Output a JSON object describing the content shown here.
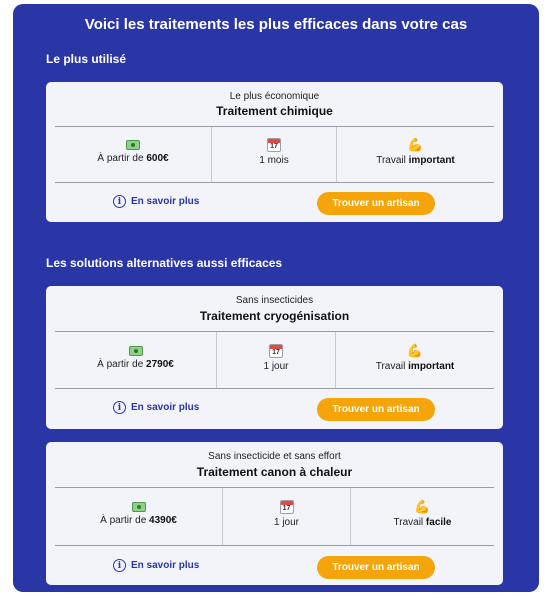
{
  "header": {
    "title": "Voici les traitements les plus efficaces dans votre cas"
  },
  "sections": [
    {
      "title": "Le plus utilisé"
    },
    {
      "title": "Les solutions alternatives aussi efficaces"
    }
  ],
  "cards": [
    {
      "subtitle": "Le plus économique",
      "name": "Traitement chimique",
      "price_prefix": "À partir de ",
      "price": "600€",
      "duration": "1 mois",
      "effort_prefix": "Travail ",
      "effort": "important",
      "info_label": "En savoir plus",
      "cta_label": "Trouver un artisan"
    },
    {
      "subtitle": "Sans insecticides",
      "name": "Traitement cryogénisation",
      "price_prefix": "À partir de ",
      "price": "2790€",
      "duration": "1 jour",
      "effort_prefix": "Travail ",
      "effort": "important",
      "info_label": "En savoir plus",
      "cta_label": "Trouver un artisan"
    },
    {
      "subtitle": "Sans insecticide et sans effort",
      "name": "Traitement canon à chaleur",
      "price_prefix": "À partir de ",
      "price": "4390€",
      "duration": "1 jour",
      "effort_prefix": "Travail ",
      "effort": "facile",
      "info_label": "En savoir plus",
      "cta_label": "Trouver un artisan"
    }
  ],
  "icons": {
    "price": "money-icon",
    "duration": "calendar-icon",
    "effort": "flexed-biceps-icon",
    "info": "info-icon",
    "calendar_day": "17"
  },
  "colors": {
    "panel": "#2b36a6",
    "card": "#f3f4fa",
    "cta": "#f5a50a",
    "link": "#2b36a6"
  }
}
